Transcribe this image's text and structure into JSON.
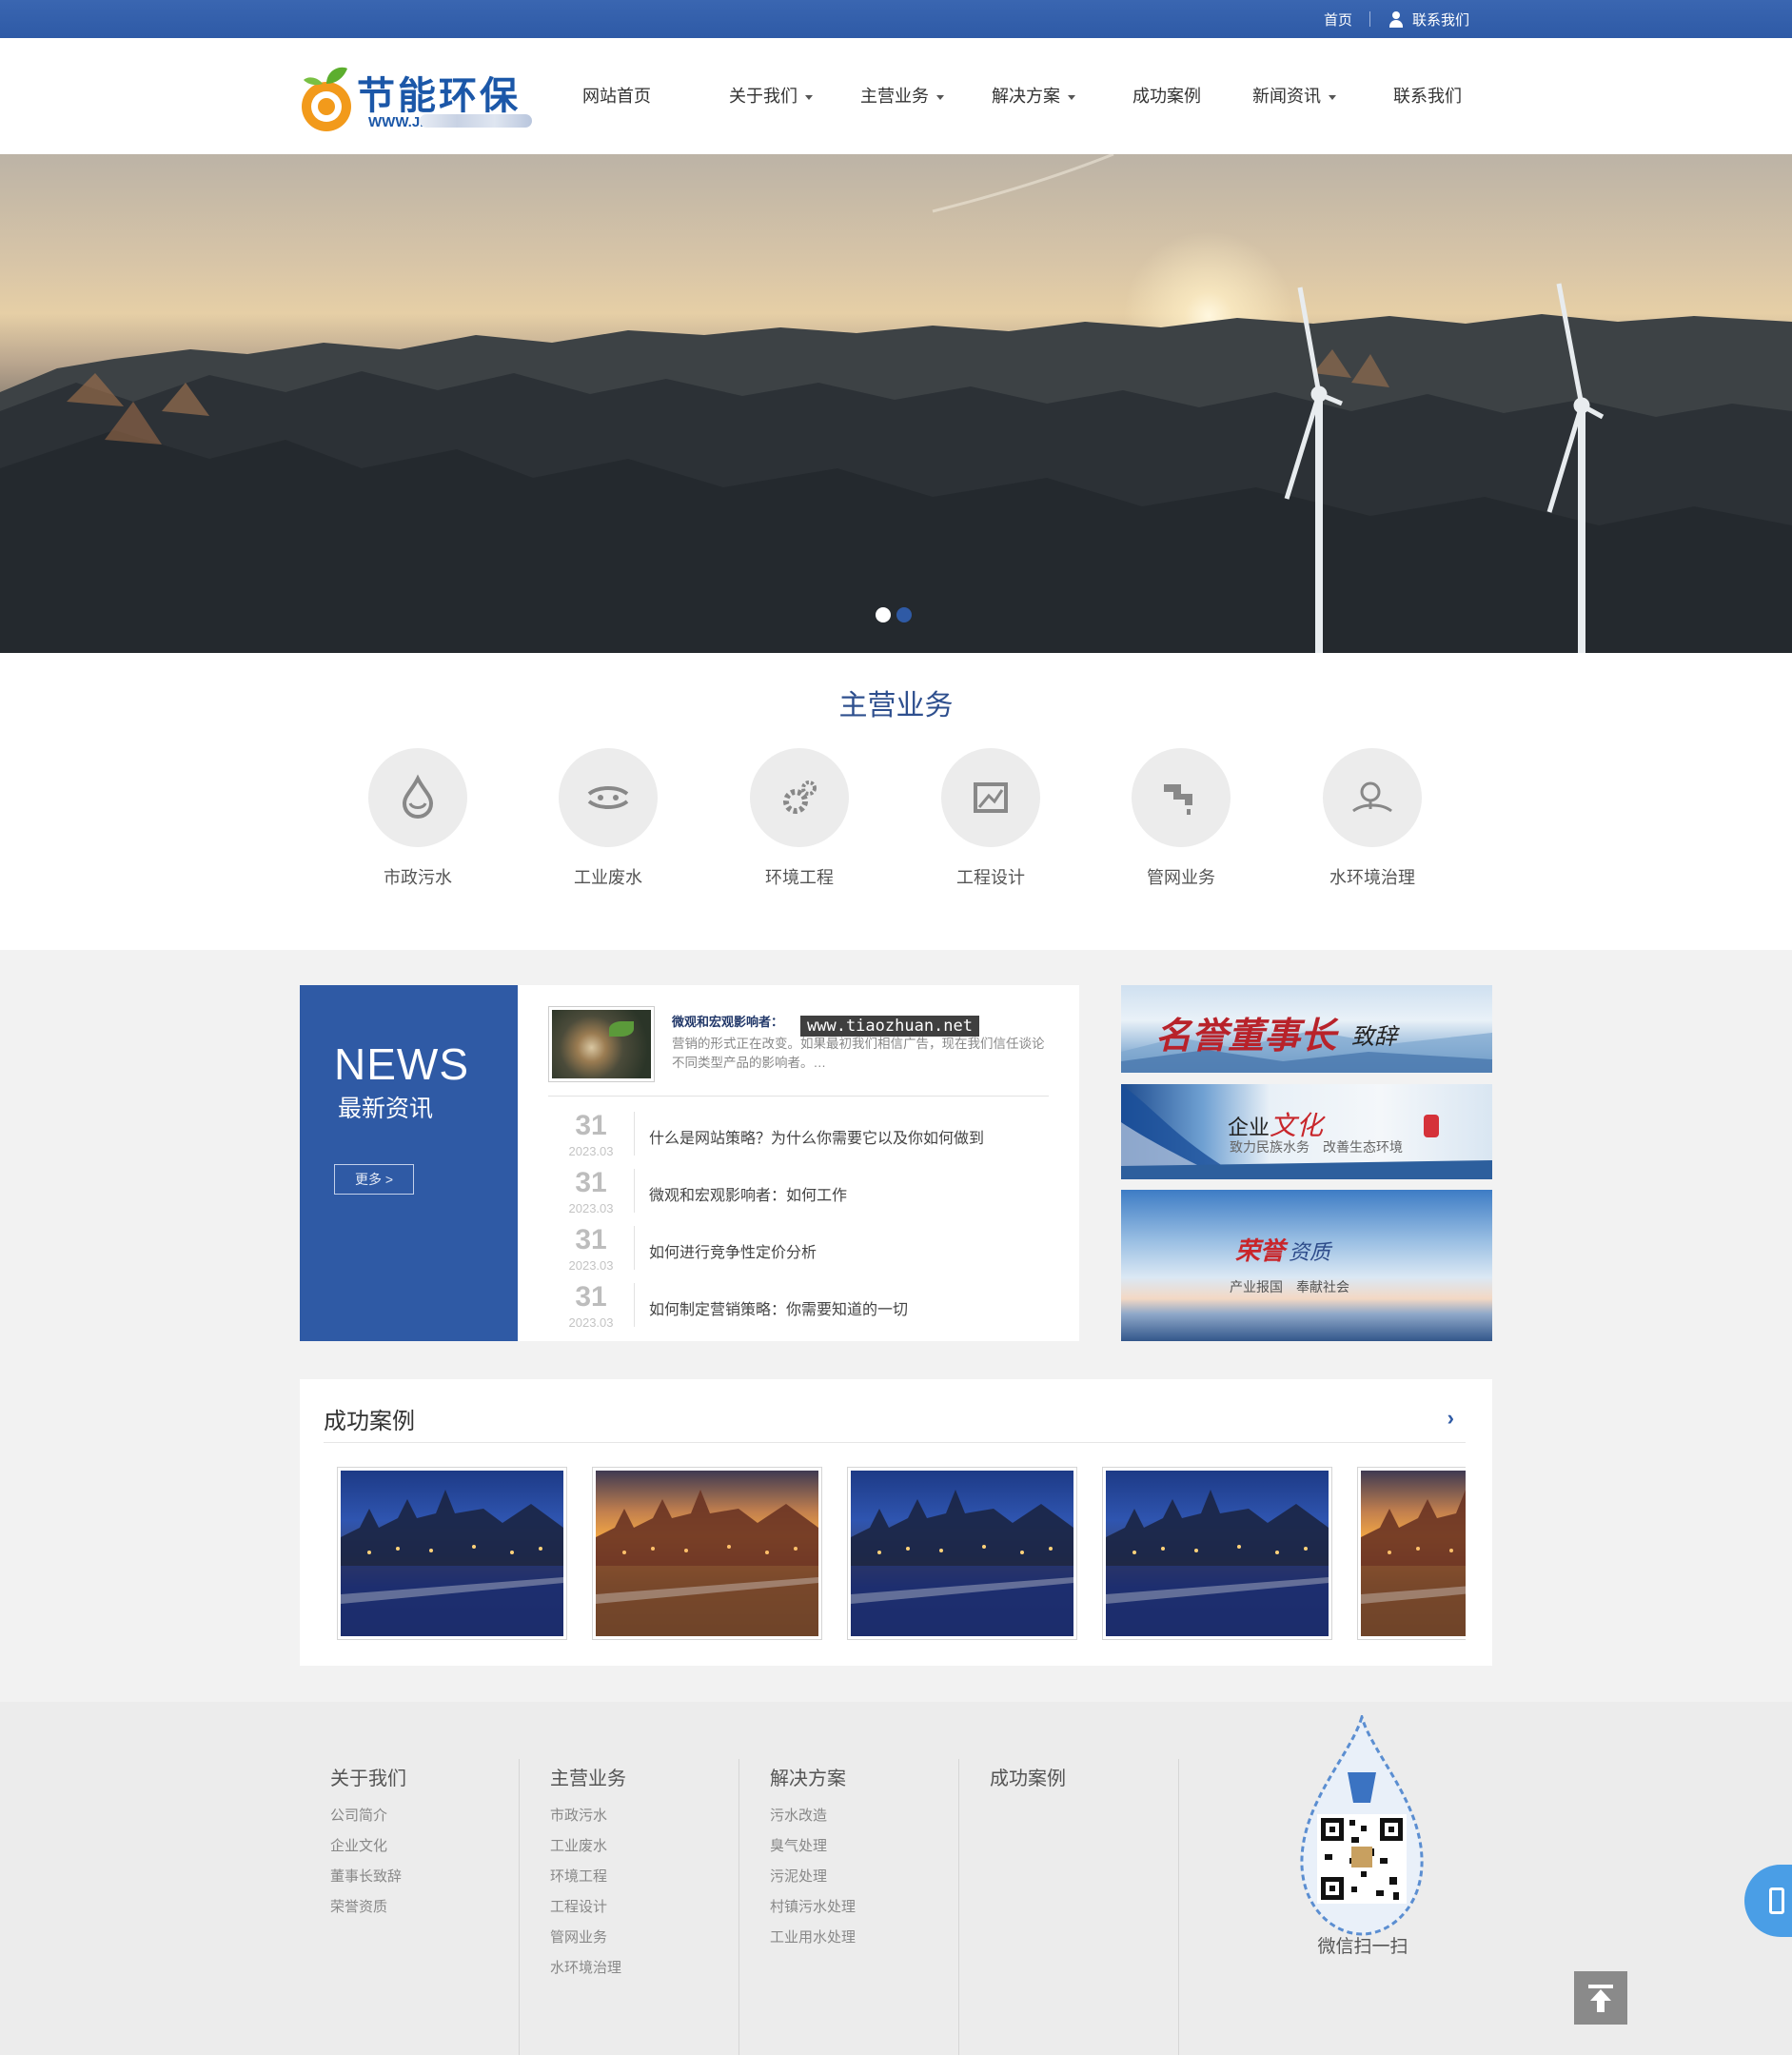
{
  "topbar": {
    "home": "首页",
    "contact": "联系我们"
  },
  "logo": {
    "name": "节能环保",
    "url": "WWW.JB"
  },
  "nav": [
    {
      "label": "网站首页",
      "dropdown": false
    },
    {
      "label": "关于我们",
      "dropdown": true
    },
    {
      "label": "主营业务",
      "dropdown": true
    },
    {
      "label": "解决方案",
      "dropdown": true
    },
    {
      "label": "成功案例",
      "dropdown": false
    },
    {
      "label": "新闻资讯",
      "dropdown": true
    },
    {
      "label": "联系我们",
      "dropdown": false
    }
  ],
  "banner": {
    "slides": 2,
    "active_slide": 1
  },
  "services": {
    "title": "主营业务",
    "items": [
      {
        "label": "市政污水",
        "icon": "water-drop-icon"
      },
      {
        "label": "工业废水",
        "icon": "pipe-flow-icon"
      },
      {
        "label": "环境工程",
        "icon": "gears-icon"
      },
      {
        "label": "工程设计",
        "icon": "drawing-icon"
      },
      {
        "label": "管网业务",
        "icon": "faucet-icon"
      },
      {
        "label": "水环境治理",
        "icon": "landscape-icon"
      }
    ]
  },
  "news": {
    "en_title": "NEWS",
    "cn_title": "最新资讯",
    "more": "更多 >",
    "featured": {
      "title": "微观和宏观影响者：",
      "desc": "营销的形式正在改变。如果最初我们相信广告，现在我们信任谈论不同类型产品的影响者。…"
    },
    "watermark": "www.tiaozhuan.net",
    "items": [
      {
        "day": "31",
        "ym": "2023.03",
        "title": "什么是网站策略？为什么你需要它以及你如何做到"
      },
      {
        "day": "31",
        "ym": "2023.03",
        "title": "微观和宏观影响者：如何工作"
      },
      {
        "day": "31",
        "ym": "2023.03",
        "title": "如何进行竞争性定价分析"
      },
      {
        "day": "31",
        "ym": "2023.03",
        "title": "如何制定营销策略：你需要知道的一切"
      }
    ]
  },
  "promos": [
    {
      "title": "名誉董事长",
      "title_small": "致辞",
      "sub": ""
    },
    {
      "title": "企业",
      "title_accent": "文化",
      "sub": "致力民族水务　改善生态环境"
    },
    {
      "title": "荣誉",
      "title_accent": "资质",
      "sub": "产业报国　奉献社会"
    }
  ],
  "cases": {
    "title": "成功案例",
    "arrow": "›",
    "items": [
      {
        "scene": "night"
      },
      {
        "scene": "sunset"
      },
      {
        "scene": "night"
      },
      {
        "scene": "night"
      },
      {
        "scene": "sunset"
      }
    ]
  },
  "footer": {
    "columns": [
      {
        "head": "关于我们",
        "items": [
          "公司简介",
          "企业文化",
          "董事长致辞",
          "荣誉资质"
        ]
      },
      {
        "head": "主营业务",
        "items": [
          "市政污水",
          "工业废水",
          "环境工程",
          "工程设计",
          "管网业务",
          "水环境治理"
        ]
      },
      {
        "head": "解决方案",
        "items": [
          "污水改造",
          "臭气处理",
          "污泥处理",
          "村镇污水处理",
          "工业用水处理"
        ]
      },
      {
        "head": "成功案例",
        "items": []
      }
    ],
    "qr_label": "微信扫一扫"
  },
  "colors": {
    "primary": "#2f5aa5",
    "topbar": "#3462ad",
    "footer_bg": "#ececec",
    "accent_red": "#c8262b"
  }
}
